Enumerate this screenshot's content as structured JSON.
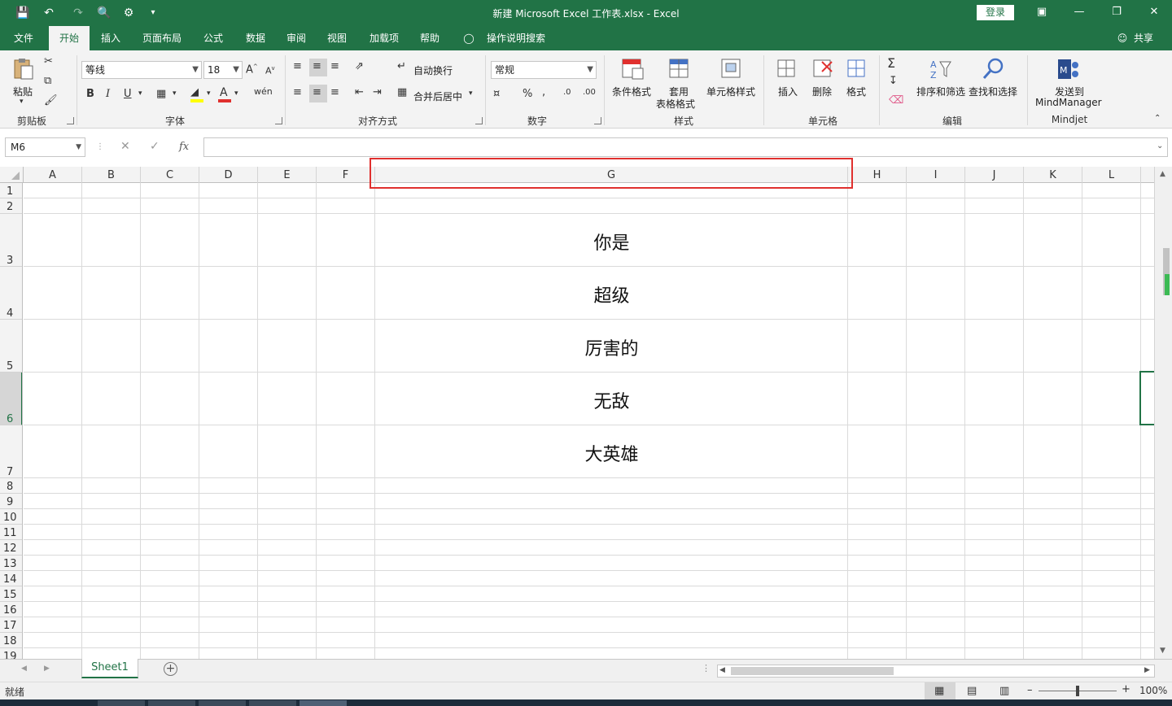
{
  "window": {
    "title": "新建 Microsoft Excel 工作表.xlsx  -  Excel",
    "login_label": "登录"
  },
  "tabs": [
    {
      "label": "文件"
    },
    {
      "label": "开始"
    },
    {
      "label": "插入"
    },
    {
      "label": "页面布局"
    },
    {
      "label": "公式"
    },
    {
      "label": "数据"
    },
    {
      "label": "审阅"
    },
    {
      "label": "视图"
    },
    {
      "label": "加载项"
    },
    {
      "label": "帮助"
    }
  ],
  "tell_me": "操作说明搜索",
  "share_label": "共享",
  "ribbon": {
    "clipboard": {
      "paste": "粘贴",
      "group": "剪贴板"
    },
    "font": {
      "name": "等线",
      "size": "18",
      "group": "字体"
    },
    "alignment": {
      "wrap": "自动换行",
      "merge": "合并后居中",
      "group": "对齐方式"
    },
    "number": {
      "format": "常规",
      "group": "数字"
    },
    "styles": {
      "conditional": "条件格式",
      "table_line1": "套用",
      "table_line2": "表格格式",
      "cell_styles": "单元格样式",
      "group": "样式"
    },
    "cells": {
      "insert": "插入",
      "delete": "删除",
      "format": "格式",
      "group": "单元格"
    },
    "editing": {
      "sort": "排序和筛选",
      "find": "查找和选择",
      "group": "编辑"
    },
    "mindjet": {
      "send_line1": "发送到",
      "send_line2": "MindManager",
      "group": "Mindjet"
    }
  },
  "formula_bar": {
    "name_box": "M6",
    "fx": "fx",
    "value": ""
  },
  "columns": [
    "A",
    "B",
    "C",
    "D",
    "E",
    "F",
    "G",
    "H",
    "I",
    "J",
    "K",
    "L"
  ],
  "rows": [
    "1",
    "2",
    "3",
    "4",
    "5",
    "6",
    "7",
    "8",
    "9",
    "10",
    "11",
    "12",
    "13",
    "14",
    "15",
    "16",
    "17",
    "18",
    "19"
  ],
  "cells_G": [
    "你是",
    "超级",
    "厉害的",
    "无敌",
    "大英雄"
  ],
  "sheet_tab": "Sheet1",
  "status": {
    "ready": "就绪",
    "zoom": "100%"
  },
  "colors": {
    "brand": "#217346",
    "highlight": "#e0302e"
  }
}
